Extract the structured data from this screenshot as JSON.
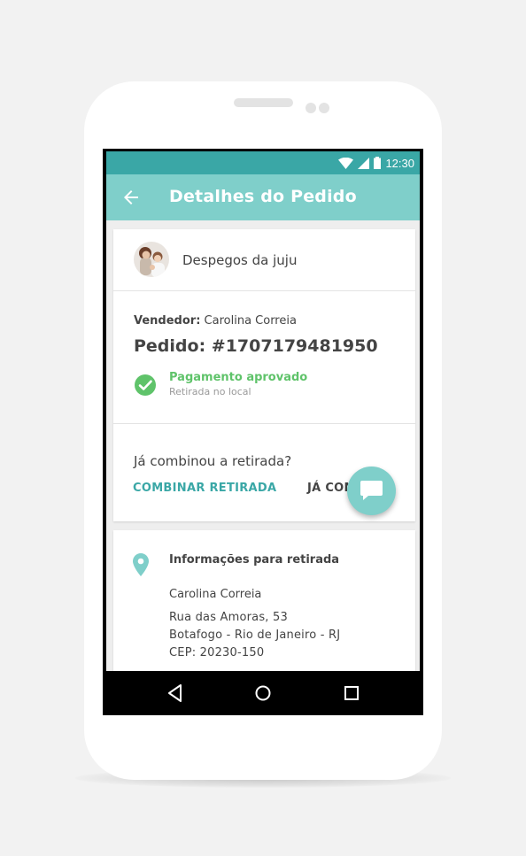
{
  "status_bar": {
    "time": "12:30"
  },
  "app_bar": {
    "title": "Detalhes do Pedido"
  },
  "store": {
    "name": "Despegos da juju"
  },
  "order": {
    "vendor_label": "Vendedor:",
    "vendor_name": "Carolina Correia",
    "number": "Pedido: #1707179481950",
    "payment_status": "Pagamento aprovado",
    "delivery_mode": "Retirada no local"
  },
  "pickup_prompt": {
    "question": "Já combinou a retirada?",
    "combine_label": "COMBINAR RETIRADA",
    "done_label": "JÁ COMBINEI"
  },
  "pickup_info": {
    "title": "Informações para retirada",
    "name": "Carolina Correia",
    "address_line1": "Rua das Amoras, 53",
    "address_line2": "Botafogo - Rio de Janeiro - RJ",
    "address_line3": "CEP: 20230-150"
  },
  "colors": {
    "status_bar": "#3aa7a6",
    "app_bar": "#7fcfca",
    "accent": "#3aa7a6",
    "success": "#5fc36a"
  }
}
